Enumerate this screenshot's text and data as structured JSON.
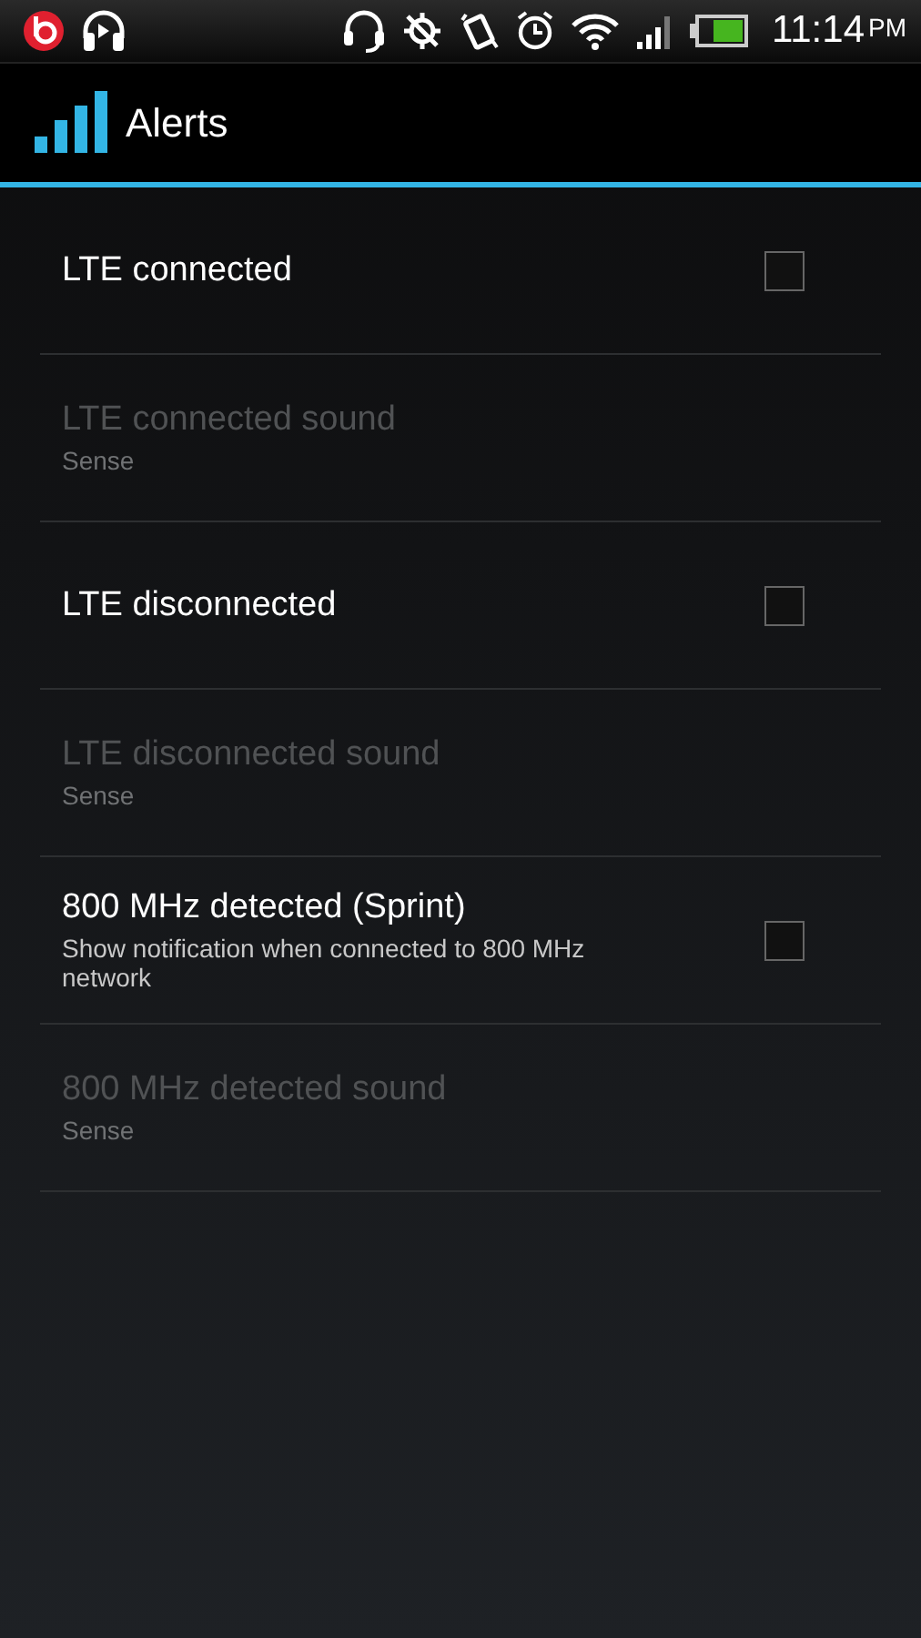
{
  "status_bar": {
    "time": "11:14",
    "ampm": "PM"
  },
  "action_bar": {
    "title": "Alerts"
  },
  "preferences": [
    {
      "kind": "checkbox",
      "title": "LTE connected",
      "disabled": false,
      "checked": false
    },
    {
      "kind": "sound",
      "title": "LTE connected sound",
      "summary": "Sense",
      "disabled": true
    },
    {
      "kind": "checkbox",
      "title": "LTE disconnected",
      "disabled": false,
      "checked": false
    },
    {
      "kind": "sound",
      "title": "LTE disconnected sound",
      "summary": "Sense",
      "disabled": true
    },
    {
      "kind": "checkbox",
      "title": "800 MHz detected (Sprint)",
      "summary": "Show notification when connected to 800 MHz network",
      "disabled": false,
      "checked": false
    },
    {
      "kind": "sound",
      "title": "800 MHz detected sound",
      "summary": "Sense",
      "disabled": true
    }
  ]
}
